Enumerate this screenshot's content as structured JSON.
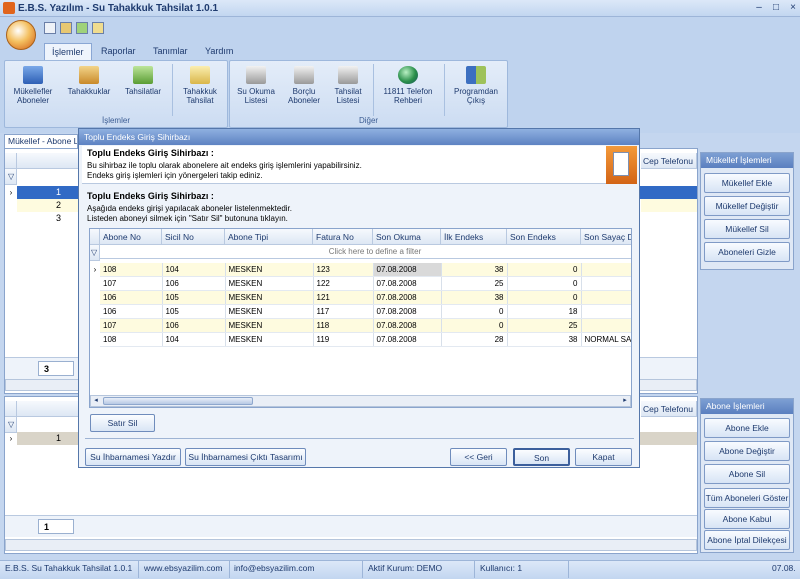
{
  "app": {
    "title": "E.B.S. Yazılım - Su Tahakkuk Tahsilat 1.0.1"
  },
  "ribbon": {
    "tabs": [
      "İşlemler",
      "Raporlar",
      "Tanımlar",
      "Yardım"
    ],
    "groups": {
      "islemler": "İşlemler",
      "diger": "Diğer"
    },
    "buttons": {
      "mukellefler": "Mükellefler\nAboneler",
      "tahakkuklar": "Tahakkuklar",
      "tahsilatlar": "Tahsilatlar",
      "tahakkuk_tahsilat": "Tahakkuk\nTahsilat",
      "su_okuma": "Su Okuma\nListesi",
      "borclu": "Borçlu\nAboneler",
      "tahsilat_listesi": "Tahsilat\nListesi",
      "rehber": "11811 Telefon\nRehberi",
      "cikis": "Programdan\nÇıkış"
    }
  },
  "main": {
    "tab_label": "Mükellef - Abone Li",
    "upper_rows": [
      "1",
      "2",
      "3"
    ],
    "upper_count": "3",
    "lower_rows": [
      "1"
    ],
    "lower_count": "1",
    "col_cep_telefonu": "Cep Telefonu"
  },
  "side": {
    "mukellef_head": "Mükellef İşlemleri",
    "mukellef_buttons": [
      "Mükellef Ekle",
      "Mükellef Değiştir",
      "Mükellef Sil",
      "Aboneleri Gizle"
    ],
    "abone_head": "Abone İşlemleri",
    "abone_buttons": [
      "Abone Ekle",
      "Abone Değiştir",
      "Abone Sil",
      "Tüm Aboneleri Göster",
      "Abone Kabul Dilekçesi",
      "Abone İptal Dilekçesi"
    ]
  },
  "dialog": {
    "title": "Toplu Endeks Giriş Sihirbazı",
    "header_title": "Toplu Endeks Giriş  Sihirbazı :",
    "header_line1": "Bu sihirbaz ile toplu olarak abonelere ait endeks giriş işlemlerini yapabilirsiniz.",
    "header_line2": "Endeks giriş işlemleri için yönergeleri takip ediniz.",
    "section_title": "Toplu Endeks Giriş  Sihirbazı :",
    "section_line1": "Aşağıda endeks girişi yapılacak aboneler listelenmektedir.",
    "section_line2": "Listeden aboneyi silmek için \"Satır Sil\" butonuna tıklayın.",
    "columns": [
      "Abone No",
      "Sicil No",
      "Abone Tipi",
      "Fatura No",
      "Son Okuma",
      "İlk Endeks",
      "Son Endeks",
      "Son Sayaç Du"
    ],
    "filter_placeholder": "Click here to define a filter",
    "rows": [
      {
        "abone_no": "108",
        "sicil_no": "104",
        "abone_tipi": "MESKEN",
        "fatura_no": "123",
        "son_okuma": "07.08.2008",
        "ilk_endeks": "38",
        "son_endeks": "0",
        "durum": ""
      },
      {
        "abone_no": "107",
        "sicil_no": "106",
        "abone_tipi": "MESKEN",
        "fatura_no": "122",
        "son_okuma": "07.08.2008",
        "ilk_endeks": "25",
        "son_endeks": "0",
        "durum": ""
      },
      {
        "abone_no": "106",
        "sicil_no": "105",
        "abone_tipi": "MESKEN",
        "fatura_no": "121",
        "son_okuma": "07.08.2008",
        "ilk_endeks": "38",
        "son_endeks": "0",
        "durum": ""
      },
      {
        "abone_no": "106",
        "sicil_no": "105",
        "abone_tipi": "MESKEN",
        "fatura_no": "117",
        "son_okuma": "07.08.2008",
        "ilk_endeks": "0",
        "son_endeks": "18",
        "durum": ""
      },
      {
        "abone_no": "107",
        "sicil_no": "106",
        "abone_tipi": "MESKEN",
        "fatura_no": "118",
        "son_okuma": "07.08.2008",
        "ilk_endeks": "0",
        "son_endeks": "25",
        "durum": ""
      },
      {
        "abone_no": "108",
        "sicil_no": "104",
        "abone_tipi": "MESKEN",
        "fatura_no": "119",
        "son_okuma": "07.08.2008",
        "ilk_endeks": "28",
        "son_endeks": "38",
        "durum": "NORMAL SAY"
      }
    ],
    "btn_satir_sil": "Satır Sil",
    "btn_yazdir": "Su İhbarnamesi Yazdır",
    "btn_tasarim": "Su İhbarnamesi Çıktı Tasarımı",
    "btn_geri": "<< Geri",
    "btn_son": "Son",
    "btn_kapat": "Kapat"
  },
  "status": {
    "app": "E.B.S. Su Tahakkuk Tahsilat 1.0.1",
    "web": "www.ebsyazilim.com",
    "email": "info@ebsyazilim.com",
    "kurum": "Aktif Kurum: DEMO",
    "kullanici": "Kullanıcı: 1",
    "date": "07.08."
  }
}
